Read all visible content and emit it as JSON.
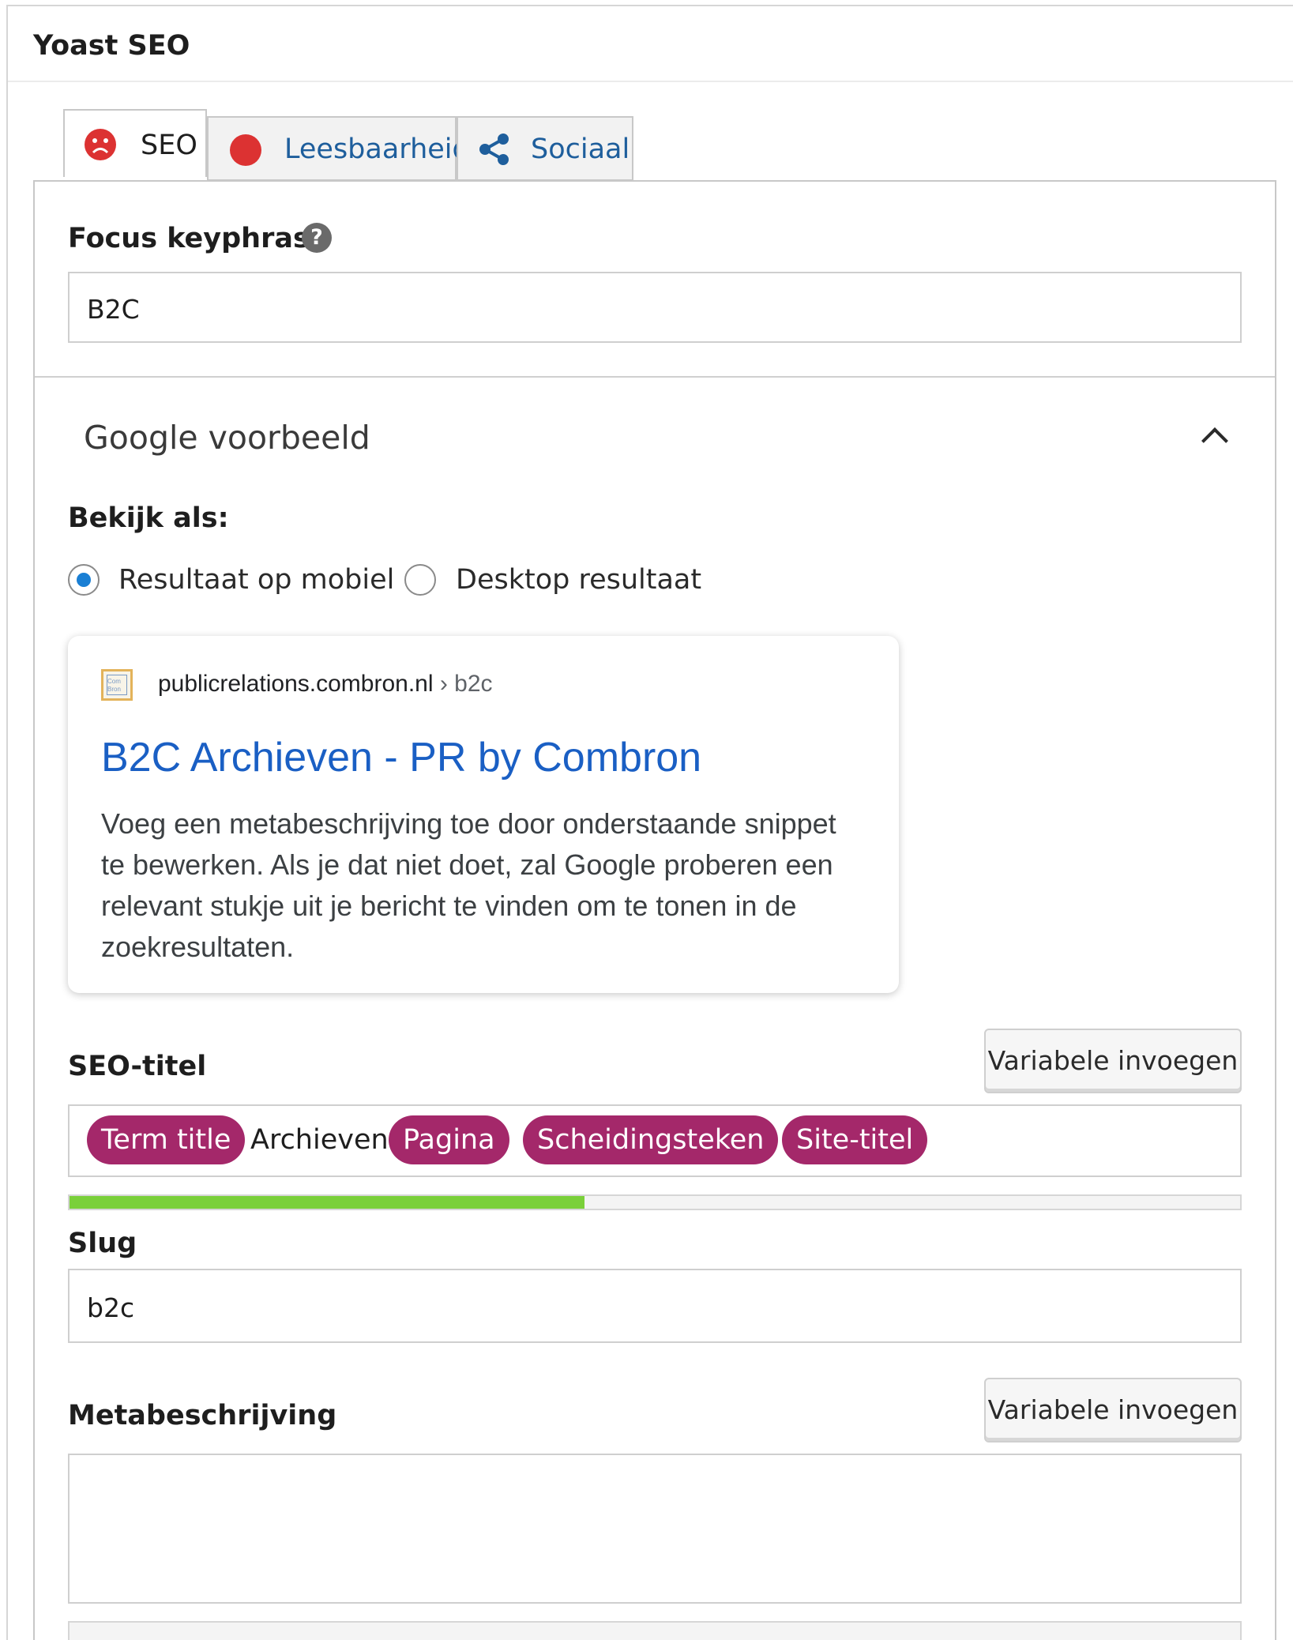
{
  "panel": {
    "title": "Yoast SEO"
  },
  "tabs": [
    {
      "label": "SEO",
      "icon": "sad-face-icon",
      "icon_color": "#dc3232",
      "active": true
    },
    {
      "label": "Leesbaarheid",
      "icon": "red-dot-icon",
      "icon_color": "#dc3232",
      "active": false
    },
    {
      "label": "Sociaal",
      "icon": "share-icon",
      "icon_color": "#1e5e9c",
      "active": false
    }
  ],
  "focus": {
    "label": "Focus keyphrase",
    "help": "?",
    "value": "B2C"
  },
  "google_preview": {
    "title": "Google voorbeeld",
    "view_as_label": "Bekijk als:",
    "options": [
      {
        "label": "Resultaat op mobiel",
        "selected": true
      },
      {
        "label": "Desktop resultaat",
        "selected": false
      }
    ],
    "card": {
      "favicon_text": "Com Bron",
      "url": "publicrelations.combron.nl",
      "breadcrumb": "› b2c",
      "title": "B2C Archieven - PR by Combron",
      "description": "Voeg een metabeschrijving toe door onderstaande snippet te bewerken. Als je dat niet doet, zal Google proberen een relevant stukje uit je bericht te vinden om te tonen in de zoekresultaten."
    }
  },
  "seo_title": {
    "label": "SEO-titel",
    "insert_button": "Variabele invoegen",
    "tokens": [
      {
        "text": "Term title",
        "variable": true
      },
      {
        "text": "Archieven",
        "variable": false
      },
      {
        "text": "Pagina",
        "variable": true
      },
      {
        "text": "Scheidingsteken",
        "variable": true
      },
      {
        "text": "Site-titel",
        "variable": true
      }
    ],
    "progress_percent": 44,
    "progress_color": "#7ad03a"
  },
  "slug": {
    "label": "Slug",
    "value": "b2c"
  },
  "meta": {
    "label": "Metabeschrijving",
    "insert_button": "Variabele invoegen",
    "value": ""
  },
  "colors": {
    "variable_pill": "#a4286a",
    "link_blue": "#1a5fc4",
    "radio_blue": "#1a7fd4"
  }
}
